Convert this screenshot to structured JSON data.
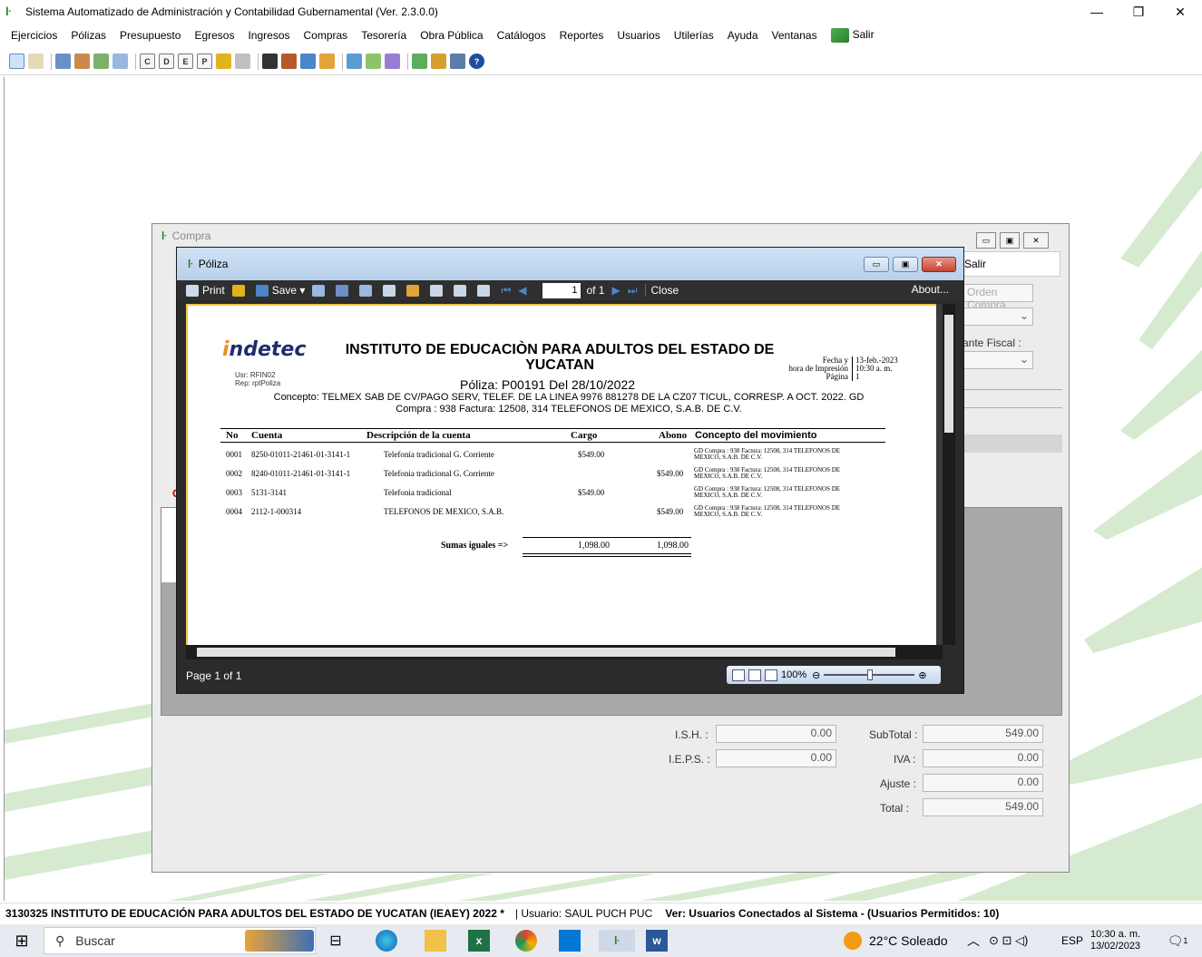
{
  "window": {
    "title": "Sistema Automatizado de Administración y Contabilidad Gubernamental  (Ver. 2.3.0.0)",
    "minimize": "—",
    "maximize": "❐",
    "close": "✕"
  },
  "menu": {
    "items": [
      "Ejercicios",
      "Pólizas",
      "Presupuesto",
      "Egresos",
      "Ingresos",
      "Compras",
      "Tesorería",
      "Obra Pública",
      "Catálogos",
      "Reportes",
      "Usuarios",
      "Utilerías",
      "Ayuda",
      "Ventanas"
    ],
    "salir": "Salir"
  },
  "toolbar": {
    "letter_buttons": [
      "C",
      "D",
      "E",
      "P"
    ]
  },
  "compra": {
    "title": "Compra",
    "salir": "Salir",
    "orden_compra": "Orden Compra",
    "comprobante_fiscal_label": "ante Fiscal :",
    "letter_c": "C",
    "totals": {
      "ish_label": "I.S.H. :",
      "ish_value": "0.00",
      "ieps_label": "I.E.P.S. :",
      "ieps_value": "0.00",
      "subtotal_label": "SubTotal :",
      "subtotal_value": "549.00",
      "iva_label": "IVA :",
      "iva_value": "0.00",
      "ajuste_label": "Ajuste :",
      "ajuste_value": "0.00",
      "total_label": "Total :",
      "total_value": "549.00"
    }
  },
  "poliza_window": {
    "title": "Póliza",
    "print": "Print",
    "save": "Save",
    "page_current": "1",
    "page_of": "of 1",
    "close": "Close",
    "about": "About...",
    "status_page": "Page 1 of 1",
    "zoom": "100%"
  },
  "report": {
    "logo_o": "i",
    "logo_rest": "ndetec",
    "usr": "Usr: RFIN02",
    "rep": "Rep: rptPoliza",
    "institution": "INSTITUTO DE EDUCACIÒN PARA ADULTOS DEL ESTADO DE YUCATAN",
    "fecha_label": "Fecha y",
    "fecha_value": "13-feb.-2023",
    "hora_label": "hora de Impresión",
    "hora_value": "10:30 a. m.",
    "pagina_label": "Página",
    "pagina_value": "1",
    "poliza_line": "Póliza:  P00191  Del 28/10/2022",
    "concepto_line1": "Concepto: TELMEX SAB DE CV/PAGO SERV, TELEF. DE LA LINEA 9976 881278 DE LA CZ07 TICUL, CORRESP. A OCT. 2022. GD",
    "concepto_line2": "Compra : 938 Factura: 12508, 314 TELEFONOS DE MEXICO, S.A.B. DE C.V.",
    "columns": {
      "no": "No",
      "cuenta": "Cuenta",
      "descripcion": "Descripción de la cuenta",
      "cargo": "Cargo",
      "abono": "Abono",
      "concepto": "Concepto del movimiento"
    },
    "rows": [
      {
        "no": "0001",
        "cuenta": "8250-01011-21461-01-3141-1",
        "descripcion": "Telefonia tradicional G. Corriente",
        "cargo": "$549.00",
        "abono": "",
        "concepto1": "GD Compra : 938 Factura: 12508, 314 TELEFONOS DE",
        "concepto2": "MEXICO, S.A.B. DE C.V."
      },
      {
        "no": "0002",
        "cuenta": "8240-01011-21461-01-3141-1",
        "descripcion": "Telefonia tradicional G. Corriente",
        "cargo": "",
        "abono": "$549.00",
        "concepto1": "GD Compra : 938 Factura: 12508, 314 TELEFONOS DE",
        "concepto2": "MEXICO, S.A.B. DE C.V."
      },
      {
        "no": "0003",
        "cuenta": "5131-3141",
        "descripcion": "Telefonia tradicional",
        "cargo": "$549.00",
        "abono": "",
        "concepto1": "GD Compra : 938 Factura: 12508, 314 TELEFONOS DE",
        "concepto2": "MEXICO, S.A.B. DE C.V."
      },
      {
        "no": "0004",
        "cuenta": "2112-1-000314",
        "descripcion": "TELEFONOS DE MEXICO, S.A.B.",
        "cargo": "",
        "abono": "$549.00",
        "concepto1": "GD Compra : 938 Factura: 12508, 314 TELEFONOS DE",
        "concepto2": "MEXICO, S.A.B. DE C.V."
      }
    ],
    "sumas_label": "Sumas iguales =>",
    "sumas_cargo": "1,098.00",
    "sumas_abono": "1,098.00"
  },
  "statusbar": {
    "entity": "3130325 INSTITUTO DE EDUCACIÓN PARA ADULTOS DEL ESTADO DE YUCATAN (IEAEY)  2022  *",
    "user": "| Usuario: SAUL PUCH PUC",
    "connected": "Ver: Usuarios Conectados al Sistema - (Usuarios Permitidos: 10)"
  },
  "taskbar": {
    "search": "Buscar",
    "weather": "22°C  Soleado",
    "lang": "ESP",
    "time": "10:30 a. m.",
    "date": "13/02/2023",
    "notif": "1"
  },
  "colors": {
    "accent_green": "#2e7d32",
    "report_border": "#f0c44c",
    "logo_blue": "#1f2d6b",
    "logo_orange": "#f08a24"
  }
}
